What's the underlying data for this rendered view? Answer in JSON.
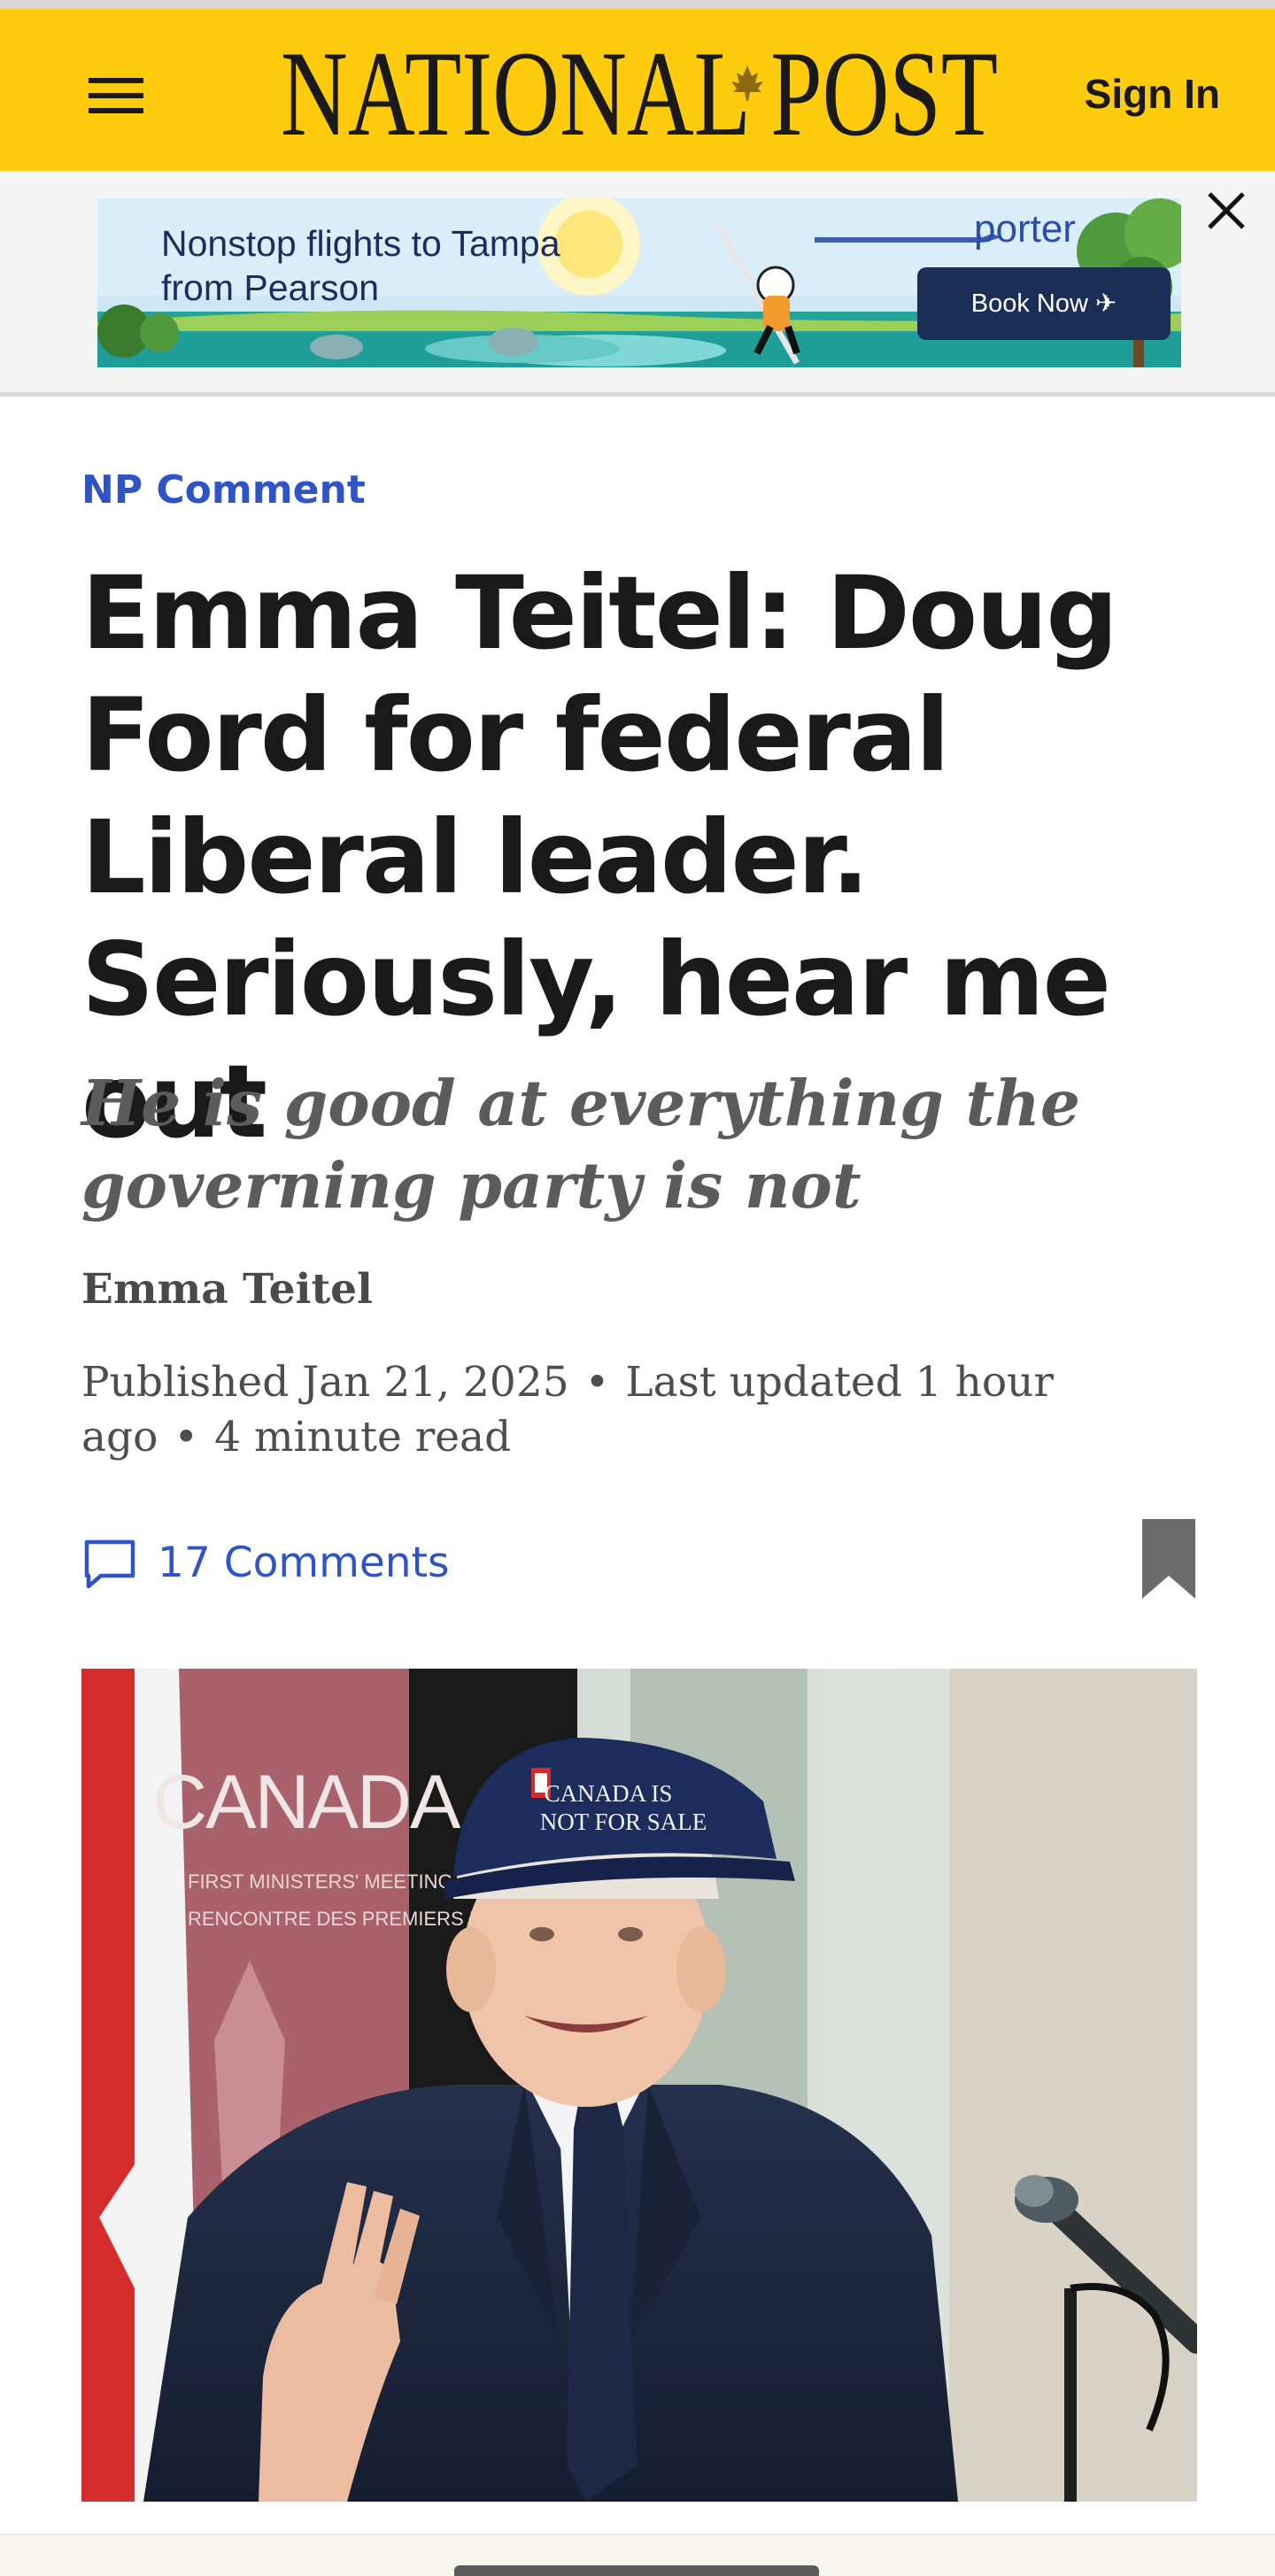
{
  "header": {
    "logo_text": "NATIONAL POST",
    "sign_in_label": "Sign In",
    "background_color": "#ffcc0d",
    "menu_icon": "hamburger-menu-icon",
    "logo_icon": "maple-leaf-icon"
  },
  "ad": {
    "headline": "Nonstop flights to Tampa from Pearson",
    "brand": "porter",
    "cta_label": "Book Now ✈",
    "close_icon": "close-icon"
  },
  "article": {
    "category": "NP Comment",
    "headline": "Emma Teitel: Doug Ford for federal Liberal leader. Seriously, hear me out",
    "subheadline": "He is good at everything the governing party is not",
    "author": "Emma Teitel",
    "published": "Published Jan 21, 2025",
    "updated": "Last updated 1 hour ago",
    "read_time": "4 minute read",
    "separator": "•",
    "comments_label": "17 Comments",
    "comments_icon": "comment-bubble-icon",
    "bookmark_icon": "bookmark-icon",
    "accent_color": "#2f54c8"
  },
  "hero_image": {
    "backdrop_text": "CANADA",
    "backdrop_subtext_1": "FIRST MINISTERS' MEETING",
    "backdrop_subtext_2": "RENCONTRE DES PREMIERS MINISTRES",
    "hat_text_line_1": "CANADA IS",
    "hat_text_line_2": "NOT FOR SALE"
  }
}
